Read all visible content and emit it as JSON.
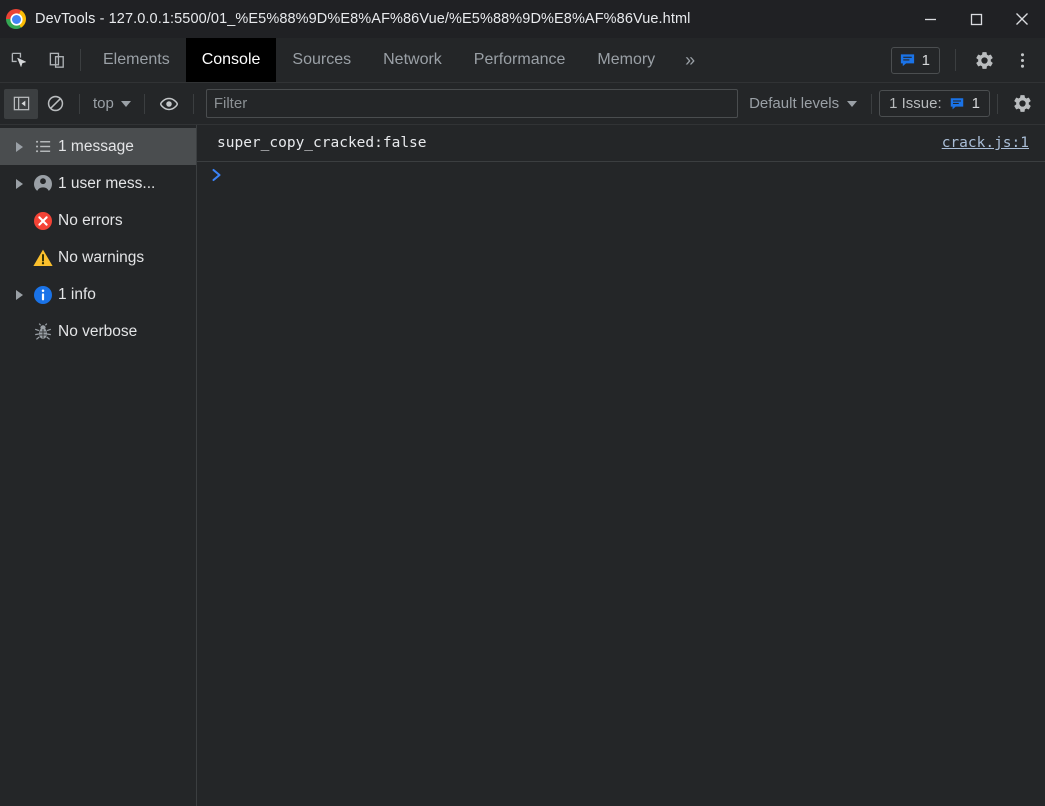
{
  "window": {
    "title": "DevTools - 127.0.0.1:5500/01_%E5%88%9D%E8%AF%86Vue/%E5%88%9D%E8%AF%86Vue.html",
    "app_icon": "chrome-logo",
    "controls": {
      "minimize": "minimize-icon",
      "maximize": "maximize-icon",
      "close": "close-icon"
    }
  },
  "tabbar": {
    "inspect_icon": "inspect-element-icon",
    "device_icon": "device-toolbar-icon",
    "tabs": [
      {
        "label": "Elements",
        "active": false
      },
      {
        "label": "Console",
        "active": true
      },
      {
        "label": "Sources",
        "active": false
      },
      {
        "label": "Network",
        "active": false
      },
      {
        "label": "Performance",
        "active": false
      },
      {
        "label": "Memory",
        "active": false
      }
    ],
    "overflow_label": "»",
    "message_badge": {
      "icon": "message-bubble-icon",
      "count": "1",
      "color": "#1a73e8"
    },
    "settings_icon": "gear-icon",
    "more_icon": "kebab-menu-icon"
  },
  "console_toolbar": {
    "sidebar_toggle_icon": "show-console-sidebar-icon",
    "clear_icon": "clear-console-icon",
    "context": {
      "label": "top",
      "caret": "chevron-down-icon"
    },
    "eye_icon": "create-live-expression-icon",
    "filter": {
      "value": "",
      "placeholder": "Filter"
    },
    "levels": {
      "label": "Default levels",
      "caret": "chevron-down-icon"
    },
    "issues": {
      "label": "1 Issue:",
      "icon": "message-bubble-icon",
      "count": "1"
    },
    "settings_icon": "gear-icon"
  },
  "sidebar": {
    "items": [
      {
        "label": "1 message",
        "icon": "list-icon",
        "arrow": true,
        "selected": true
      },
      {
        "label": "1 user mess...",
        "icon": "user-icon",
        "arrow": true,
        "selected": false
      },
      {
        "label": "No errors",
        "icon": "error-icon",
        "arrow": false,
        "selected": false
      },
      {
        "label": "No warnings",
        "icon": "warning-icon",
        "arrow": false,
        "selected": false
      },
      {
        "label": "1 info",
        "icon": "info-icon",
        "arrow": true,
        "selected": false
      },
      {
        "label": "No verbose",
        "icon": "bug-icon",
        "arrow": false,
        "selected": false
      }
    ]
  },
  "console": {
    "messages": [
      {
        "text": "super_copy_cracked:false",
        "source": "crack.js:1"
      }
    ],
    "prompt": {
      "chevron": "prompt-chevron-icon",
      "value": ""
    }
  },
  "colors": {
    "accent_blue": "#1a73e8",
    "error_red": "#f44336",
    "warning_yellow": "#fbc02d",
    "info_blue": "#1a73e8",
    "background": "#242628",
    "titlebar": "#202124",
    "active_tab": "#000000",
    "selected_row": "#4a4d4f"
  }
}
